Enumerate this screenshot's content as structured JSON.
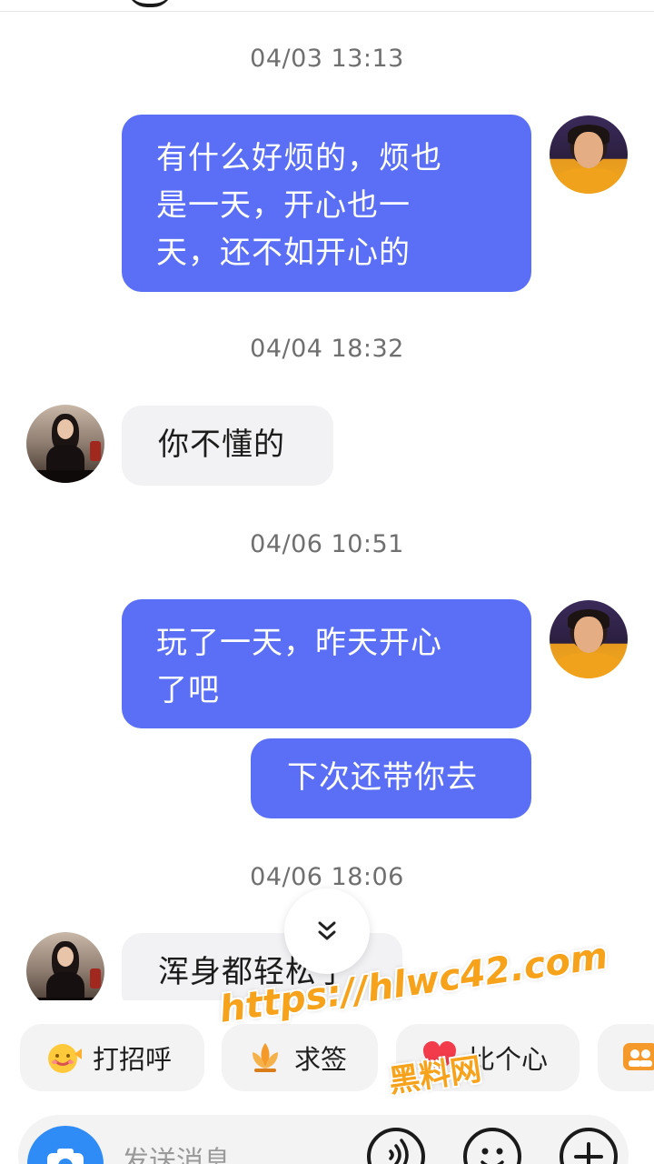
{
  "conversation": [
    {
      "type": "timestamp",
      "text": "04/03 13:13"
    },
    {
      "type": "message",
      "from": "me",
      "lines": [
        "有什么好烦的，烦也",
        "是一天，开心也一",
        "天，还不如开心的"
      ]
    },
    {
      "type": "timestamp",
      "text": "04/04 18:32"
    },
    {
      "type": "message",
      "from": "her",
      "lines": [
        "你不懂的"
      ]
    },
    {
      "type": "timestamp",
      "text": "04/06 10:51"
    },
    {
      "type": "message",
      "from": "me",
      "lines": [
        "玩了一天，昨天开心",
        "了吧"
      ]
    },
    {
      "type": "message",
      "from": "me",
      "lines": [
        "下次还带你去"
      ]
    },
    {
      "type": "timestamp",
      "text": "04/06 18:06"
    },
    {
      "type": "message",
      "from": "her",
      "lines": [
        "浑身都轻松了"
      ]
    }
  ],
  "scroll_down": {
    "icon": "double-chevron-down-icon",
    "glyph": "︾"
  },
  "quick_actions": [
    {
      "label": "打招呼",
      "icon": "smile-wave-icon"
    },
    {
      "label": "求签",
      "icon": "lotus-icon"
    },
    {
      "label": "比个心",
      "icon": "heart-icon"
    },
    {
      "label": "",
      "icon": "group-chat-icon"
    }
  ],
  "input": {
    "placeholder": "发送消息",
    "camera_icon": "camera-icon",
    "voice_icon": "voice-icon",
    "emoji_icon": "emoji-icon",
    "plus_icon": "plus-icon"
  },
  "watermark": {
    "url": "https://hlwc42.com",
    "subtitle": "黑料网"
  },
  "colors": {
    "sent_bubble": "#5a6ff5",
    "received_bubble": "#f2f2f4",
    "timestamp_text": "#6f6f6f",
    "watermark": "#f7a21b",
    "camera_button": "#2f8cf7"
  }
}
